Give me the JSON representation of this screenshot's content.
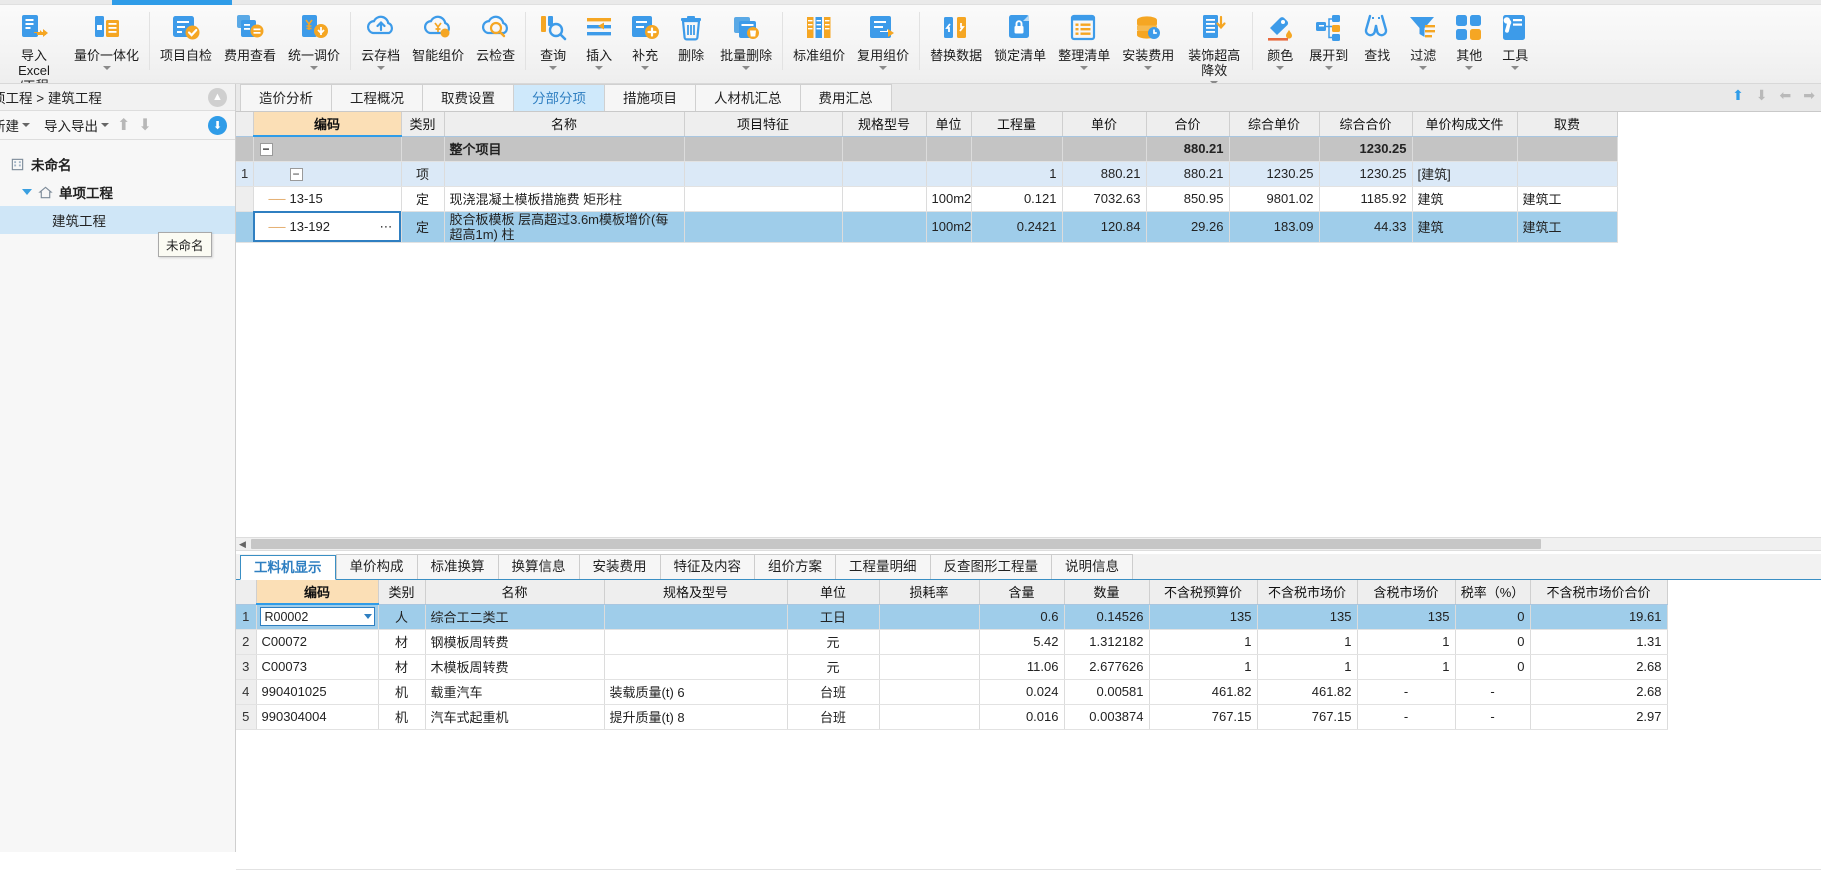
{
  "ribbon": {
    "buttons": [
      {
        "label": "导入Excel\n/工程",
        "icon": "import-excel-icon",
        "caret": true,
        "two": true
      },
      {
        "label": "量价一体化",
        "icon": "quantity-price-icon",
        "caret": true
      },
      {
        "label": "项目自检",
        "icon": "project-selfcheck-icon",
        "caret": false
      },
      {
        "label": "费用查看",
        "icon": "fee-view-icon",
        "caret": false
      },
      {
        "label": "统一调价",
        "icon": "unified-price-icon",
        "caret": true
      },
      {
        "label": "云存档",
        "icon": "cloud-archive-icon",
        "caret": true
      },
      {
        "label": "智能组价",
        "icon": "smart-pricing-icon",
        "caret": false
      },
      {
        "label": "云检查",
        "icon": "cloud-check-icon",
        "caret": false
      },
      {
        "label": "查询",
        "icon": "query-icon",
        "caret": true
      },
      {
        "label": "插入",
        "icon": "insert-icon",
        "caret": true
      },
      {
        "label": "补充",
        "icon": "supplement-icon",
        "caret": true
      },
      {
        "label": "删除",
        "icon": "delete-icon",
        "caret": false
      },
      {
        "label": "批量删除",
        "icon": "batch-delete-icon",
        "caret": true
      },
      {
        "label": "标准组价",
        "icon": "standard-pricing-icon",
        "caret": false
      },
      {
        "label": "复用组价",
        "icon": "reuse-pricing-icon",
        "caret": true
      },
      {
        "label": "替换数据",
        "icon": "replace-data-icon",
        "caret": false
      },
      {
        "label": "锁定清单",
        "icon": "lock-list-icon",
        "caret": false
      },
      {
        "label": "整理清单",
        "icon": "organize-list-icon",
        "caret": true
      },
      {
        "label": "安装费用",
        "icon": "install-fee-icon",
        "caret": true
      },
      {
        "label": "装饰超高\n降效",
        "icon": "decoration-height-icon",
        "caret": true,
        "two": true
      },
      {
        "label": "颜色",
        "icon": "color-icon",
        "caret": true
      },
      {
        "label": "展开到",
        "icon": "expand-to-icon",
        "caret": true
      },
      {
        "label": "查找",
        "icon": "find-icon",
        "caret": false
      },
      {
        "label": "过滤",
        "icon": "filter-icon",
        "caret": true
      },
      {
        "label": "其他",
        "icon": "other-icon",
        "caret": true
      },
      {
        "label": "工具",
        "icon": "tools-icon",
        "caret": true
      }
    ]
  },
  "sidebar": {
    "breadcrumb": "项工程 > 建筑工程",
    "toolbar": {
      "new_label": "新建",
      "import_export_label": "导入导出",
      "up_icon": "arrow-up-icon",
      "down_icon": "arrow-down-icon",
      "download_icon": "download-icon"
    },
    "collapse_icon": "collapse-icon",
    "tooltip": "未命名",
    "tree": [
      {
        "label": "未命名",
        "level": 1,
        "icon": "building-icon",
        "selected": false
      },
      {
        "label": "单项工程",
        "level": 2,
        "icon": "home-icon",
        "selected": false
      },
      {
        "label": "建筑工程",
        "level": 3,
        "icon": "",
        "selected": true
      }
    ]
  },
  "main": {
    "tabs": [
      {
        "label": "造价分析",
        "active": false
      },
      {
        "label": "工程概况",
        "active": false
      },
      {
        "label": "取费设置",
        "active": false
      },
      {
        "label": "分部分项",
        "active": true
      },
      {
        "label": "措施项目",
        "active": false
      },
      {
        "label": "人材机汇总",
        "active": false
      },
      {
        "label": "费用汇总",
        "active": false
      }
    ],
    "nav_icons": [
      "nav-up-icon",
      "nav-down-icon",
      "nav-prev-icon",
      "nav-next-icon"
    ]
  },
  "top_table": {
    "columns": [
      "编码",
      "类别",
      "名称",
      "项目特征",
      "规格型号",
      "单位",
      "工程量",
      "单价",
      "合价",
      "综合单价",
      "综合合价",
      "单价构成文件",
      "取费"
    ],
    "rows": [
      {
        "no": "",
        "kind": "total",
        "code": "",
        "cat": "",
        "name": "整个项目",
        "feature": "",
        "spec": "",
        "unit": "",
        "qty": "",
        "price": "",
        "total": "880.21",
        "cprice": "",
        "ctotal": "1230.25",
        "file": "",
        "fee": ""
      },
      {
        "no": "1",
        "kind": "item",
        "code": "",
        "cat": "项",
        "name": "",
        "feature": "",
        "spec": "",
        "unit": "",
        "qty": "1",
        "price": "880.21",
        "total": "880.21",
        "cprice": "1230.25",
        "ctotal": "1230.25",
        "file": "[建筑]",
        "fee": ""
      },
      {
        "no": "",
        "kind": "sub",
        "code": "13-15",
        "cat": "定",
        "name": "现浇混凝土模板措施费 矩形柱",
        "feature": "",
        "spec": "",
        "unit": "100m2",
        "qty": "0.121",
        "price": "7032.63",
        "total": "850.95",
        "cprice": "9801.02",
        "ctotal": "1185.92",
        "file": "建筑",
        "fee": "建筑工"
      },
      {
        "no": "",
        "kind": "selected",
        "code": "13-192",
        "cat": "定",
        "name": "胶合板模板 层高超过3.6m模板增价(每超高1m) 柱",
        "feature": "",
        "spec": "",
        "unit": "100m2",
        "qty": "0.2421",
        "price": "120.84",
        "total": "29.26",
        "cprice": "183.09",
        "ctotal": "44.33",
        "file": "建筑",
        "fee": "建筑工"
      }
    ]
  },
  "bottom_panel": {
    "tabs": [
      {
        "label": "工料机显示",
        "active": true
      },
      {
        "label": "单价构成",
        "active": false
      },
      {
        "label": "标准换算",
        "active": false
      },
      {
        "label": "换算信息",
        "active": false
      },
      {
        "label": "安装费用",
        "active": false
      },
      {
        "label": "特征及内容",
        "active": false
      },
      {
        "label": "组价方案",
        "active": false
      },
      {
        "label": "工程量明细",
        "active": false
      },
      {
        "label": "反查图形工程量",
        "active": false
      },
      {
        "label": "说明信息",
        "active": false
      }
    ],
    "columns": [
      "编码",
      "类别",
      "名称",
      "规格及型号",
      "单位",
      "损耗率",
      "含量",
      "数量",
      "不含税预算价",
      "不含税市场价",
      "含税市场价",
      "税率（%）",
      "不含税市场价合价"
    ],
    "rows": [
      {
        "no": "1",
        "code": "R00002",
        "cat": "人",
        "name": "综合工二类工",
        "spec": "",
        "unit": "工日",
        "loss": "",
        "content": "0.6",
        "qty": "0.14526",
        "budget": "135",
        "market": "135",
        "taxmarket": "135",
        "rate": "0",
        "total": "19.61",
        "selected": true,
        "editable": true
      },
      {
        "no": "2",
        "code": "C00072",
        "cat": "材",
        "name": "钢模板周转费",
        "spec": "",
        "unit": "元",
        "loss": "",
        "content": "5.42",
        "qty": "1.312182",
        "budget": "1",
        "market": "1",
        "taxmarket": "1",
        "rate": "0",
        "total": "1.31",
        "selected": false
      },
      {
        "no": "3",
        "code": "C00073",
        "cat": "材",
        "name": "木模板周转费",
        "spec": "",
        "unit": "元",
        "loss": "",
        "content": "11.06",
        "qty": "2.677626",
        "budget": "1",
        "market": "1",
        "taxmarket": "1",
        "rate": "0",
        "total": "2.68",
        "selected": false
      },
      {
        "no": "4",
        "code": "990401025",
        "cat": "机",
        "name": "载重汽车",
        "spec": "装载质量(t) 6",
        "unit": "台班",
        "loss": "",
        "content": "0.024",
        "qty": "0.00581",
        "budget": "461.82",
        "market": "461.82",
        "taxmarket": "-",
        "rate": "-",
        "total": "2.68",
        "selected": false
      },
      {
        "no": "5",
        "code": "990304004",
        "cat": "机",
        "name": "汽车式起重机",
        "spec": "提升质量(t) 8",
        "unit": "台班",
        "loss": "",
        "content": "0.016",
        "qty": "0.003874",
        "budget": "767.15",
        "market": "767.15",
        "taxmarket": "-",
        "rate": "-",
        "total": "2.97",
        "selected": false
      }
    ]
  },
  "colors": {
    "accent": "#2f9ce8",
    "selection": "#9fcdea",
    "item_row": "#dbe9f7",
    "total_row": "#c4c4c4",
    "key_col_header": "#fbdfb6"
  }
}
